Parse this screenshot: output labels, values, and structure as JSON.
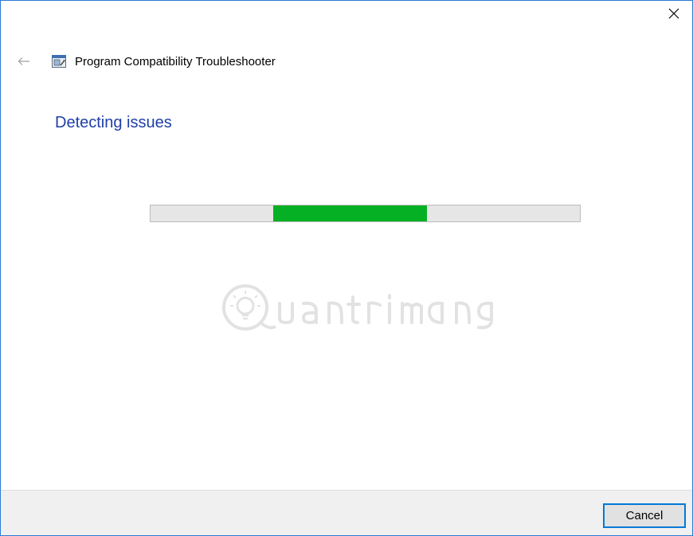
{
  "window": {
    "title": "Program Compatibility Troubleshooter",
    "close_icon": "close-icon",
    "back_icon": "back-arrow-icon",
    "app_icon": "troubleshooter-icon"
  },
  "main": {
    "heading": "Detecting issues",
    "progress": {
      "state": "indeterminate",
      "fill_color": "#06b025",
      "track_color": "#e6e6e6"
    }
  },
  "footer": {
    "cancel_label": "Cancel"
  },
  "colors": {
    "heading": "#1e3fa6",
    "window_border": "#2b7bd6",
    "focus_border": "#0078d7"
  }
}
